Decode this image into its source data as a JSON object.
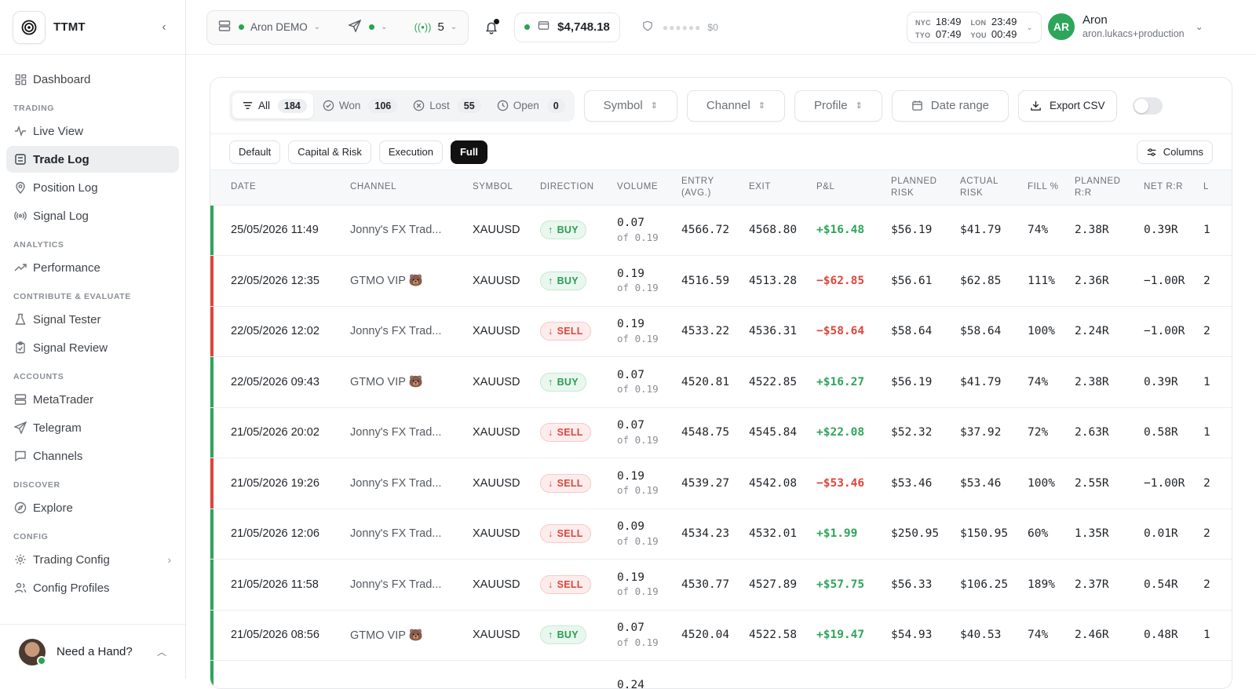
{
  "brand": {
    "name": "TTMT"
  },
  "sidebar": {
    "dashboard": "Dashboard",
    "sections": {
      "trading": "Trading",
      "analytics": "Analytics",
      "contribute": "Contribute & Evaluate",
      "accounts": "Accounts",
      "discover": "Discover",
      "config": "Config"
    },
    "items": {
      "live_view": "Live View",
      "trade_log": "Trade Log",
      "position_log": "Position Log",
      "signal_log": "Signal Log",
      "performance": "Performance",
      "signal_tester": "Signal Tester",
      "signal_review": "Signal Review",
      "metatrader": "MetaTrader",
      "telegram": "Telegram",
      "channels": "Channels",
      "explore": "Explore",
      "trading_config": "Trading Config",
      "config_profiles": "Config Profiles"
    },
    "help": "Need a Hand?"
  },
  "topbar": {
    "account": "Aron DEMO",
    "signal_count": "5",
    "balance": "$4,748.18",
    "risk_amount": "$0",
    "clocks": {
      "nyc_label": "NYC",
      "nyc_time": "18:49",
      "tyo_label": "TYO",
      "tyo_time": "07:49",
      "lon_label": "LON",
      "lon_time": "23:49",
      "you_label": "YOU",
      "you_time": "00:49"
    },
    "user": {
      "initials": "AR",
      "name": "Aron",
      "email": "aron.lukacs+production"
    }
  },
  "filters": {
    "all_label": "All",
    "all_count": "184",
    "won_label": "Won",
    "won_count": "106",
    "lost_label": "Lost",
    "lost_count": "55",
    "open_label": "Open",
    "open_count": "0",
    "symbol": "Symbol",
    "channel": "Channel",
    "profile": "Profile",
    "date_range": "Date range",
    "export": "Export CSV"
  },
  "presets": {
    "default": "Default",
    "capital_risk": "Capital & Risk",
    "execution": "Execution",
    "full": "Full",
    "columns": "Columns"
  },
  "table": {
    "headers": {
      "date": "Date",
      "channel": "Channel",
      "symbol": "Symbol",
      "direction": "Direction",
      "volume": "Volume",
      "entry": "Entry (avg.)",
      "exit": "Exit",
      "pnl": "P&L",
      "planned_risk": "Planned risk",
      "actual_risk": "Actual risk",
      "fill": "Fill %",
      "planned_rr": "Planned R:R",
      "net_rr": "Net R:R",
      "next": "L"
    },
    "rows": [
      {
        "date": "25/05/2026 11:49",
        "channel": "Jonny's FX Trad...",
        "emoji": "",
        "symbol": "XAUUSD",
        "direction": "BUY",
        "volume": "0.07",
        "of": "of 0.19",
        "entry": "4566.72",
        "exit": "4568.80",
        "pnl": "+$16.48",
        "planned_risk": "$56.19",
        "actual_risk": "$41.79",
        "fill": "74%",
        "planned_rr": "2.38R",
        "net_rr": "0.39R",
        "next": "1",
        "result": "win"
      },
      {
        "date": "22/05/2026 12:35",
        "channel": "GTMO VIP",
        "emoji": "🐻",
        "symbol": "XAUUSD",
        "direction": "BUY",
        "volume": "0.19",
        "of": "of 0.19",
        "entry": "4516.59",
        "exit": "4513.28",
        "pnl": "−$62.85",
        "planned_risk": "$56.61",
        "actual_risk": "$62.85",
        "fill": "111%",
        "planned_rr": "2.36R",
        "net_rr": "−1.00R",
        "next": "2",
        "result": "loss"
      },
      {
        "date": "22/05/2026 12:02",
        "channel": "Jonny's FX Trad...",
        "emoji": "",
        "symbol": "XAUUSD",
        "direction": "SELL",
        "volume": "0.19",
        "of": "of 0.19",
        "entry": "4533.22",
        "exit": "4536.31",
        "pnl": "−$58.64",
        "planned_risk": "$58.64",
        "actual_risk": "$58.64",
        "fill": "100%",
        "planned_rr": "2.24R",
        "net_rr": "−1.00R",
        "next": "2",
        "result": "loss"
      },
      {
        "date": "22/05/2026 09:43",
        "channel": "GTMO VIP",
        "emoji": "🐻",
        "symbol": "XAUUSD",
        "direction": "BUY",
        "volume": "0.07",
        "of": "of 0.19",
        "entry": "4520.81",
        "exit": "4522.85",
        "pnl": "+$16.27",
        "planned_risk": "$56.19",
        "actual_risk": "$41.79",
        "fill": "74%",
        "planned_rr": "2.38R",
        "net_rr": "0.39R",
        "next": "1",
        "result": "win"
      },
      {
        "date": "21/05/2026 20:02",
        "channel": "Jonny's FX Trad...",
        "emoji": "",
        "symbol": "XAUUSD",
        "direction": "SELL",
        "volume": "0.07",
        "of": "of 0.19",
        "entry": "4548.75",
        "exit": "4545.84",
        "pnl": "+$22.08",
        "planned_risk": "$52.32",
        "actual_risk": "$37.92",
        "fill": "72%",
        "planned_rr": "2.63R",
        "net_rr": "0.58R",
        "next": "1",
        "result": "win"
      },
      {
        "date": "21/05/2026 19:26",
        "channel": "Jonny's FX Trad...",
        "emoji": "",
        "symbol": "XAUUSD",
        "direction": "SELL",
        "volume": "0.19",
        "of": "of 0.19",
        "entry": "4539.27",
        "exit": "4542.08",
        "pnl": "−$53.46",
        "planned_risk": "$53.46",
        "actual_risk": "$53.46",
        "fill": "100%",
        "planned_rr": "2.55R",
        "net_rr": "−1.00R",
        "next": "2",
        "result": "loss"
      },
      {
        "date": "21/05/2026 12:06",
        "channel": "Jonny's FX Trad...",
        "emoji": "",
        "symbol": "XAUUSD",
        "direction": "SELL",
        "volume": "0.09",
        "of": "of 0.19",
        "entry": "4534.23",
        "exit": "4532.01",
        "pnl": "+$1.99",
        "planned_risk": "$250.95",
        "actual_risk": "$150.95",
        "fill": "60%",
        "planned_rr": "1.35R",
        "net_rr": "0.01R",
        "next": "2",
        "result": "win"
      },
      {
        "date": "21/05/2026 11:58",
        "channel": "Jonny's FX Trad...",
        "emoji": "",
        "symbol": "XAUUSD",
        "direction": "SELL",
        "volume": "0.19",
        "of": "of 0.19",
        "entry": "4530.77",
        "exit": "4527.89",
        "pnl": "+$57.75",
        "planned_risk": "$56.33",
        "actual_risk": "$106.25",
        "fill": "189%",
        "planned_rr": "2.37R",
        "net_rr": "0.54R",
        "next": "2",
        "result": "win"
      },
      {
        "date": "21/05/2026 08:56",
        "channel": "GTMO VIP",
        "emoji": "🐻",
        "symbol": "XAUUSD",
        "direction": "BUY",
        "volume": "0.07",
        "of": "of 0.19",
        "entry": "4520.04",
        "exit": "4522.58",
        "pnl": "+$19.47",
        "planned_risk": "$54.93",
        "actual_risk": "$40.53",
        "fill": "74%",
        "planned_rr": "2.46R",
        "net_rr": "0.48R",
        "next": "1",
        "result": "win"
      },
      {
        "date": "",
        "channel": "",
        "emoji": "",
        "symbol": "",
        "direction": "",
        "volume": "0.24",
        "of": "",
        "entry": "",
        "exit": "",
        "pnl": "",
        "planned_risk": "",
        "actual_risk": "",
        "fill": "",
        "planned_rr": "",
        "net_rr": "",
        "next": "",
        "result": "win"
      }
    ]
  },
  "colors": {
    "win": "#2ea55a",
    "loss": "#e0453a",
    "accent": "#111111"
  },
  "icons": [
    "logo-icon",
    "collapse-chevron-icon",
    "dashboard-icon",
    "pulse-icon",
    "list-icon",
    "pin-icon",
    "signal-icon",
    "trend-icon",
    "flask-icon",
    "clipboard-icon",
    "server-icon",
    "send-icon",
    "chat-icon",
    "compass-icon",
    "gear-icon",
    "users-icon",
    "layers-icon",
    "bell-icon",
    "wallet-icon",
    "shield-icon",
    "filter-icon",
    "check-circle-icon",
    "x-circle-icon",
    "clock-icon",
    "calendar-icon",
    "download-icon",
    "sliders-icon"
  ]
}
